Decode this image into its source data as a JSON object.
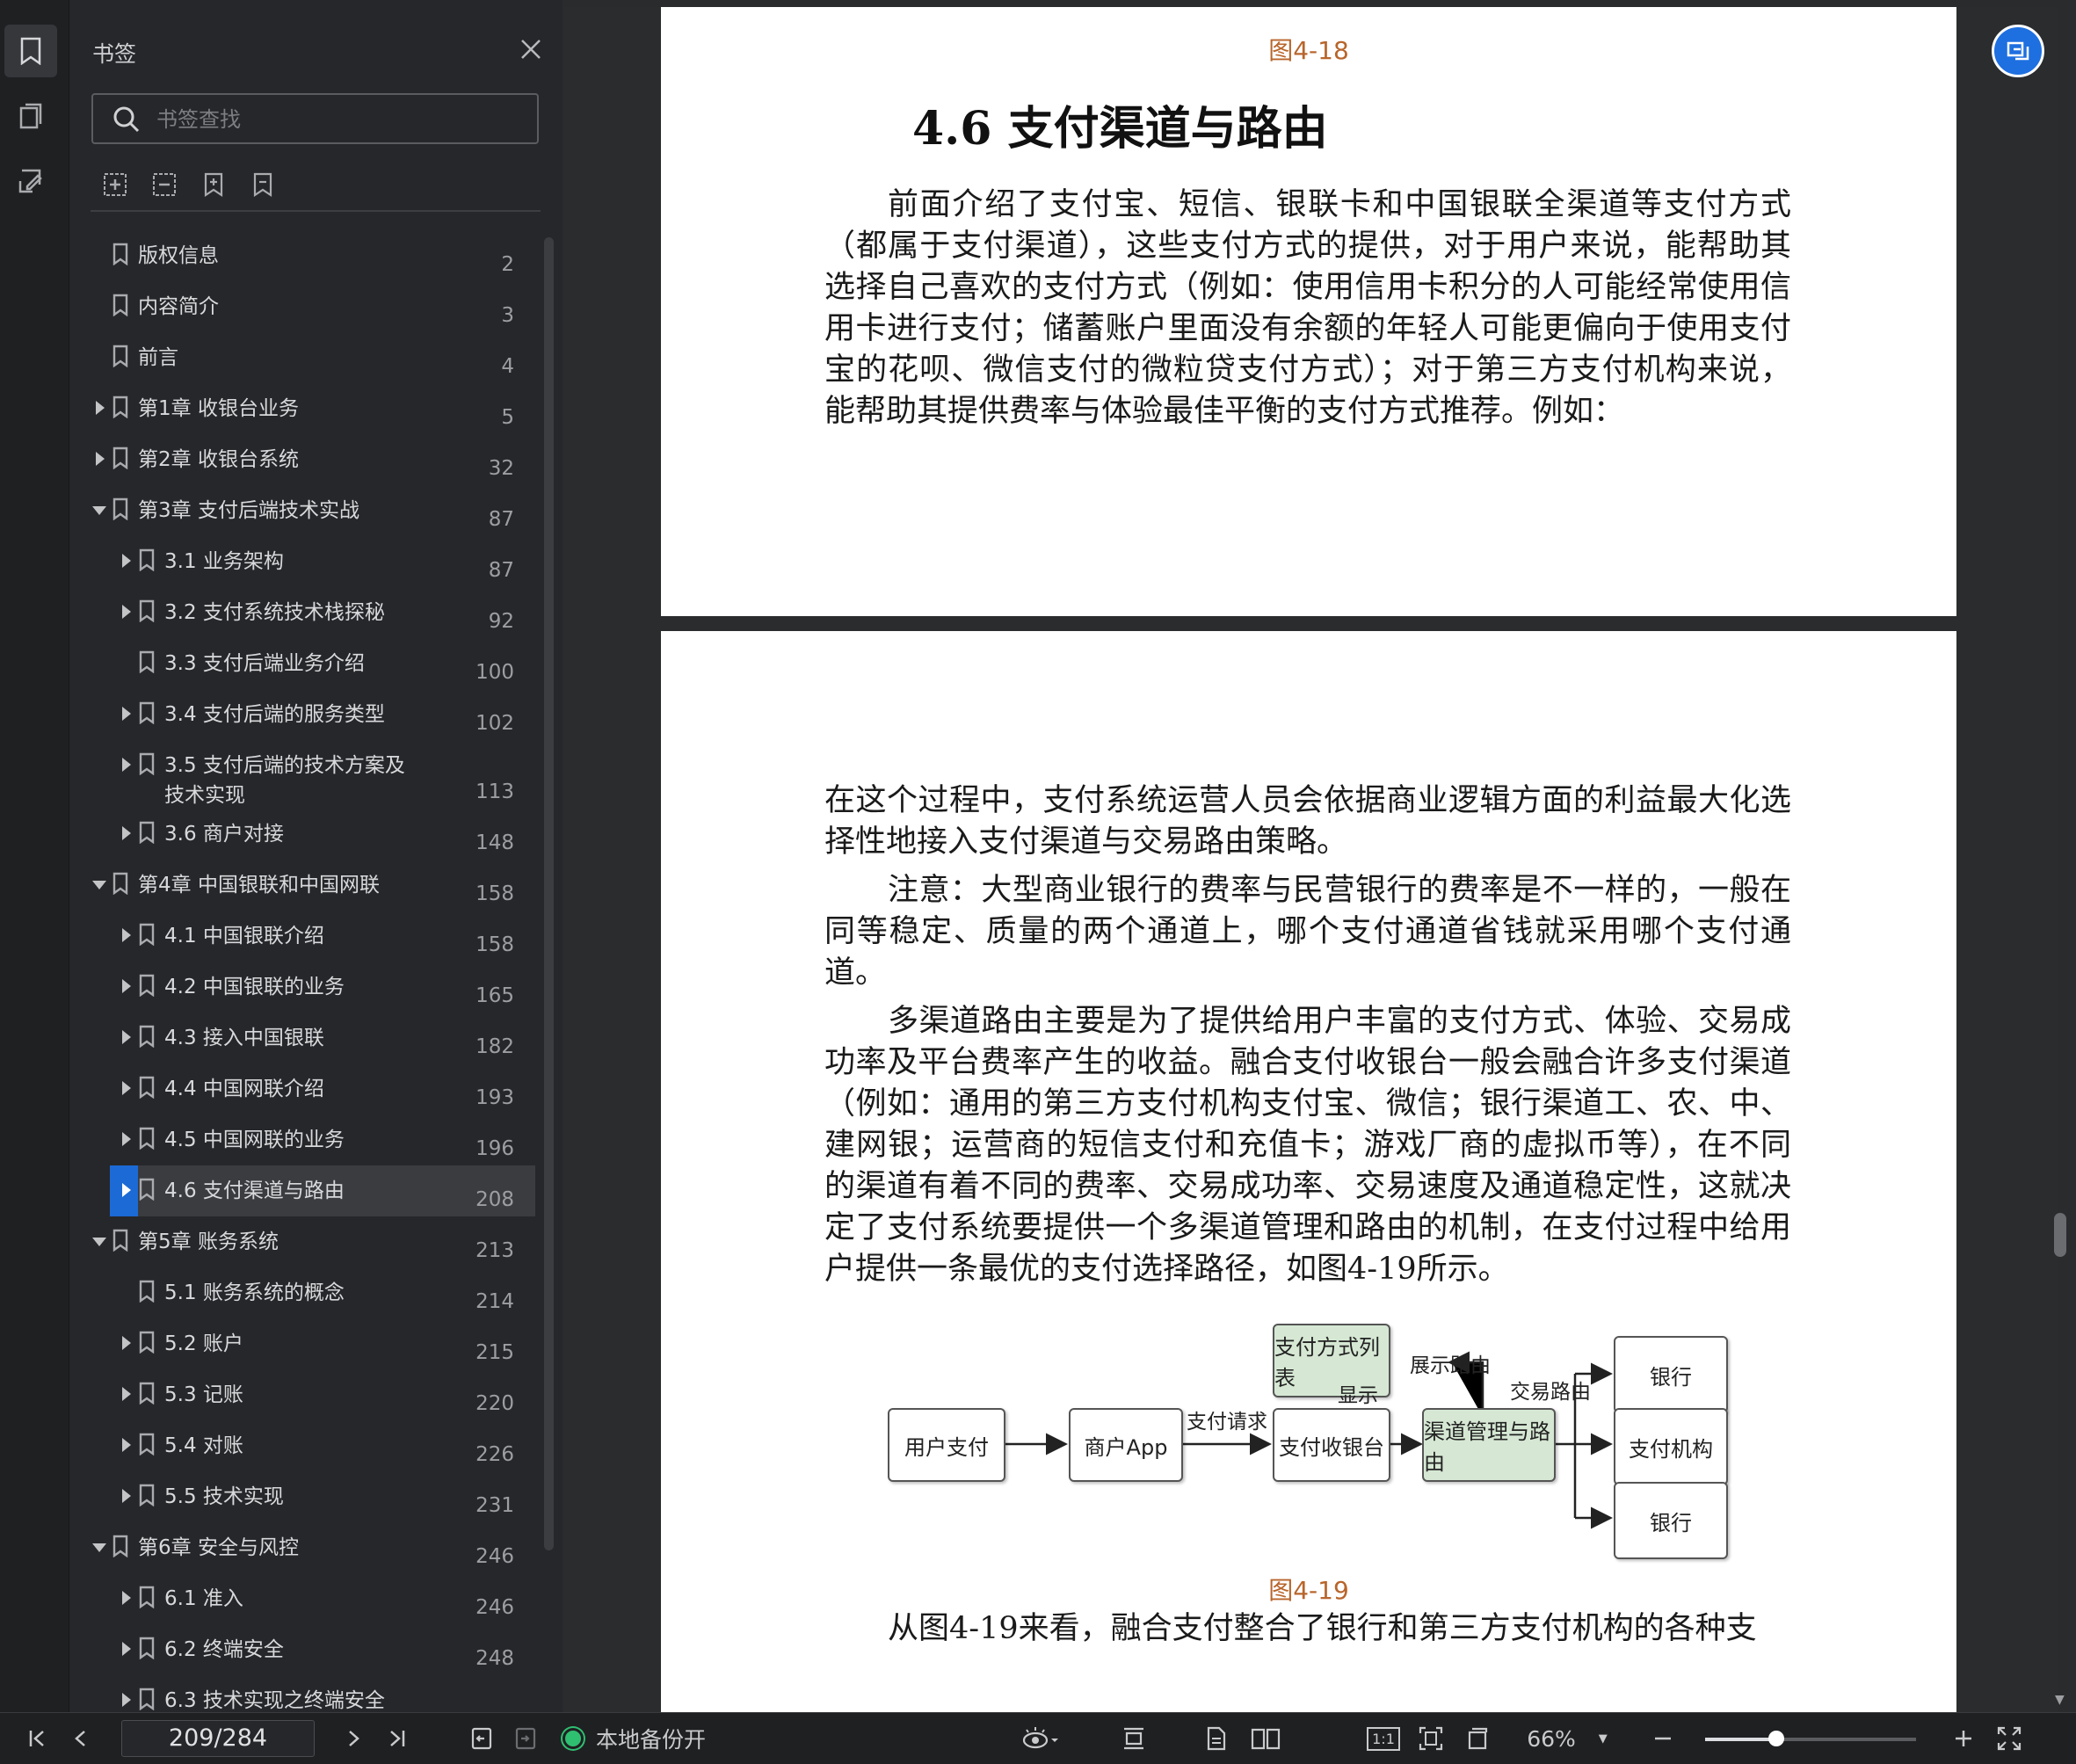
{
  "sidebar": {
    "title": "书签",
    "search_placeholder": "书签查找",
    "items": [
      {
        "label": "版权信息",
        "page": "2",
        "level": 0,
        "expander": "none"
      },
      {
        "label": "内容简介",
        "page": "3",
        "level": 0,
        "expander": "none"
      },
      {
        "label": "前言",
        "page": "4",
        "level": 0,
        "expander": "none"
      },
      {
        "label": "第1章 收银台业务",
        "page": "5",
        "level": 0,
        "expander": "collapsed"
      },
      {
        "label": "第2章 收银台系统",
        "page": "32",
        "level": 0,
        "expander": "collapsed"
      },
      {
        "label": "第3章 支付后端技术实战",
        "page": "87",
        "level": 0,
        "expander": "expanded"
      },
      {
        "label": "3.1 业务架构",
        "page": "87",
        "level": 1,
        "expander": "collapsed"
      },
      {
        "label": "3.2 支付系统技术栈探秘",
        "page": "92",
        "level": 1,
        "expander": "collapsed"
      },
      {
        "label": "3.3 支付后端业务介绍",
        "page": "100",
        "level": 1,
        "expander": "none"
      },
      {
        "label": "3.4 支付后端的服务类型",
        "page": "102",
        "level": 1,
        "expander": "collapsed"
      },
      {
        "label": "3.5 支付后端的技术方案及",
        "label2": "技术实现",
        "page": "113",
        "level": 1,
        "expander": "collapsed"
      },
      {
        "label": "3.6 商户对接",
        "page": "148",
        "level": 1,
        "expander": "collapsed"
      },
      {
        "label": "第4章 中国银联和中国网联",
        "page": "158",
        "level": 0,
        "expander": "expanded"
      },
      {
        "label": "4.1 中国银联介绍",
        "page": "158",
        "level": 1,
        "expander": "collapsed"
      },
      {
        "label": "4.2 中国银联的业务",
        "page": "165",
        "level": 1,
        "expander": "collapsed"
      },
      {
        "label": "4.3 接入中国银联",
        "page": "182",
        "level": 1,
        "expander": "collapsed"
      },
      {
        "label": "4.4 中国网联介绍",
        "page": "193",
        "level": 1,
        "expander": "collapsed"
      },
      {
        "label": "4.5 中国网联的业务",
        "page": "196",
        "level": 1,
        "expander": "collapsed"
      },
      {
        "label": "4.6 支付渠道与路由",
        "page": "208",
        "level": 1,
        "expander": "collapsed",
        "selected": true
      },
      {
        "label": "第5章 账务系统",
        "page": "213",
        "level": 0,
        "expander": "expanded"
      },
      {
        "label": "5.1 账务系统的概念",
        "page": "214",
        "level": 1,
        "expander": "none"
      },
      {
        "label": "5.2 账户",
        "page": "215",
        "level": 1,
        "expander": "collapsed"
      },
      {
        "label": "5.3 记账",
        "page": "220",
        "level": 1,
        "expander": "collapsed"
      },
      {
        "label": "5.4 对账",
        "page": "226",
        "level": 1,
        "expander": "collapsed"
      },
      {
        "label": "5.5 技术实现",
        "page": "231",
        "level": 1,
        "expander": "collapsed"
      },
      {
        "label": "第6章 安全与风控",
        "page": "246",
        "level": 0,
        "expander": "expanded"
      },
      {
        "label": "6.1 准入",
        "page": "246",
        "level": 1,
        "expander": "collapsed"
      },
      {
        "label": "6.2 终端安全",
        "page": "248",
        "level": 1,
        "expander": "collapsed"
      },
      {
        "label": "6.3 技术实现之终端安全",
        "page": "",
        "level": 1,
        "expander": "collapsed"
      }
    ]
  },
  "document": {
    "page1": {
      "caption_top": "图4-18",
      "heading": "4.6 支付渠道与路由",
      "paragraph": "前面介绍了支付宝、短信、银联卡和中国银联全渠道等支付方式（都属于支付渠道），这些支付方式的提供，对于用户来说，能帮助其选择自己喜欢的支付方式（例如：使用信用卡积分的人可能经常使用信用卡进行支付；储蓄账户里面没有余额的年轻人可能更偏向于使用支付宝的花呗、微信支付的微粒贷支付方式）；对于第三方支付机构来说，能帮助其提供费率与体验最佳平衡的支付方式推荐。例如："
    },
    "page2": {
      "p1": "在这个过程中，支付系统运营人员会依据商业逻辑方面的利益最大化选择性地接入支付渠道与交易路由策略。",
      "p2": "注意：大型商业银行的费率与民营银行的费率是不一样的，一般在同等稳定、质量的两个通道上，哪个支付通道省钱就采用哪个支付通道。",
      "p3": "多渠道路由主要是为了提供给用户丰富的支付方式、体验、交易成功率及平台费率产生的收益。融合支付收银台一般会融合许多支付渠道（例如：通用的第三方支付机构支付宝、微信；银行渠道工、农、中、建网银；运营商的短信支付和充值卡；游戏厂商的虚拟币等），在不同的渠道有着不同的费率、交易成功率、交易速度及通道稳定性，这就决定了支付系统要提供一个多渠道管理和路由的机制，在支付过程中给用户提供一条最优的支付选择路径，如图4-19所示。",
      "diagram": {
        "nodes": {
          "user_pay": "用户支付",
          "merchant_app": "商户App",
          "cashier": "支付收银台",
          "method_list": "支付方式列表",
          "channel_routing": "渠道管理与路由",
          "bank_1": "银行",
          "pay_org": "支付机构",
          "bank_2": "银行"
        },
        "edges": {
          "pay_request": "支付请求",
          "display": "显示",
          "display_route": "展示路由",
          "trade_route": "交易路由"
        }
      },
      "caption": "图4-19",
      "cut_line": "从图4-19来看，融合支付整合了银行和第三方支付机构的各种支"
    }
  },
  "bottombar": {
    "current_page": "209/284",
    "backup_status": "本地备份开",
    "zoom": "66%",
    "zoom_fraction": 0.34,
    "one_to_one": "1:1"
  },
  "colors": {
    "accent": "#1c6ad6",
    "caption": "#b8652b",
    "diagram_green": "#d6e8d4"
  }
}
